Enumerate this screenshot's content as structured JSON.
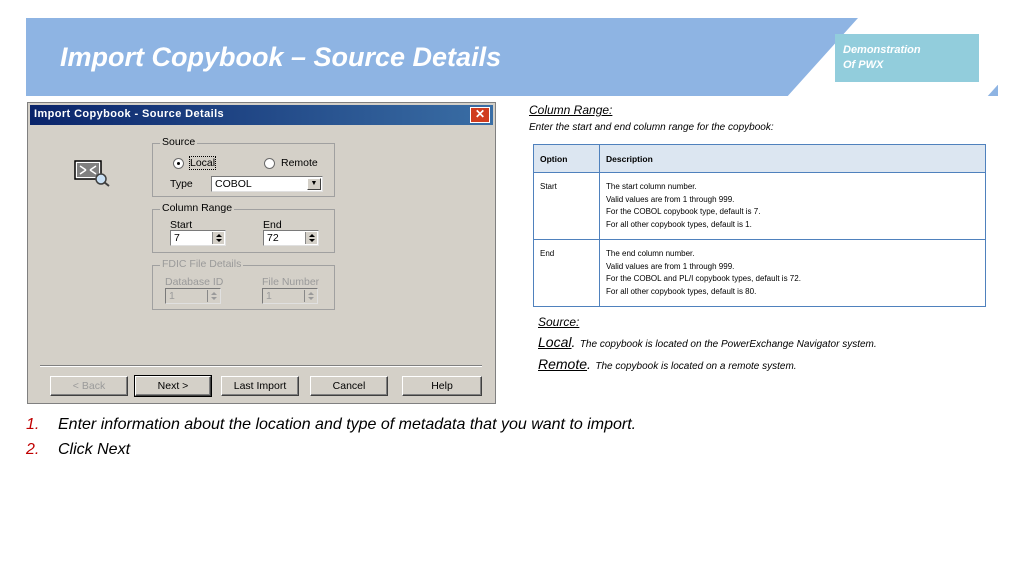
{
  "slide": {
    "title": "Import Copybook – Source Details",
    "demo_line1": "Demonstration",
    "demo_line2": "Of PWX"
  },
  "dialog": {
    "title": "Import Copybook - Source  Details",
    "close_glyph": "✕",
    "source": {
      "legend": "Source",
      "local_label": "Local",
      "remote_label": "Remote",
      "selected": "Local",
      "type_label": "Type",
      "type_value": "COBOL"
    },
    "column_range": {
      "legend": "Column Range",
      "start_label": "Start",
      "start_value": "7",
      "end_label": "End",
      "end_value": "72"
    },
    "fdic": {
      "legend": "FDIC File Details",
      "db_label": "Database ID",
      "db_value": "1",
      "file_label": "File Number",
      "file_value": "1"
    },
    "buttons": {
      "back": "< Back",
      "next": "Next >",
      "last_import": "Last Import",
      "cancel": "Cancel",
      "help": "Help"
    }
  },
  "info": {
    "column_range_heading": "Column Range:",
    "column_range_desc": "Enter the start and end column range for the copybook:",
    "table": {
      "headers": [
        "Option",
        "Description"
      ],
      "rows": [
        {
          "option": "Start",
          "lines": [
            "The start column number.",
            "Valid values are from 1 through 999.",
            "For the COBOL copybook type, default is 7.",
            "For all other copybook types, default is 1."
          ]
        },
        {
          "option": "End",
          "lines": [
            "The end column number.",
            "Valid values are from 1 through 999.",
            "For the COBOL and PL/I copybook types, default is 72.",
            "For all other copybook types, default is 80."
          ]
        }
      ]
    },
    "source_heading": "Source:",
    "local_term": "Local",
    "local_desc": "The copybook is located on the PowerExchange Navigator  system.",
    "remote_term": "Remote",
    "remote_desc": "The copybook is located on a remote  system."
  },
  "steps": [
    {
      "num": "1.",
      "text": "Enter information about the location and type of metadata that you want to import."
    },
    {
      "num": "2.",
      "text": "Click Next"
    }
  ]
}
